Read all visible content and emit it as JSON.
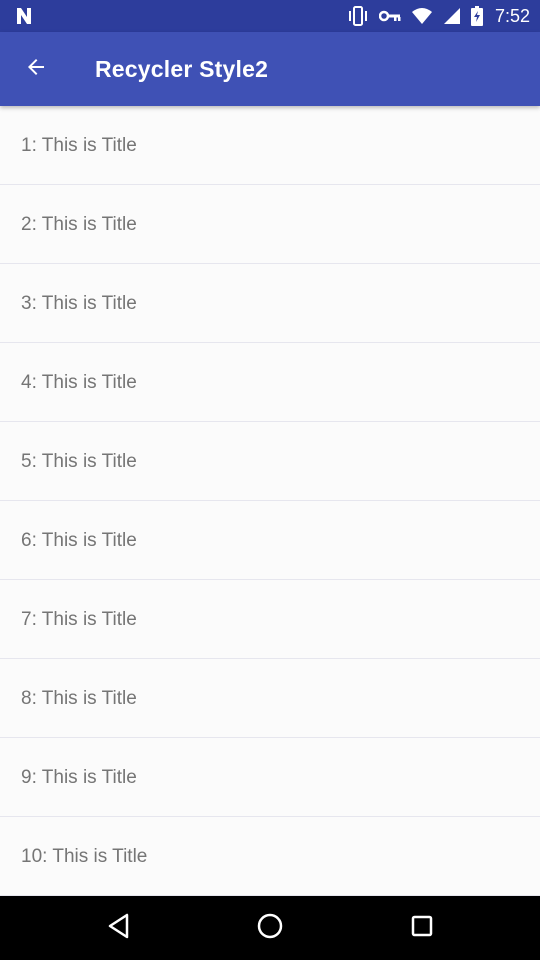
{
  "status_bar": {
    "time": "7:52",
    "icons": [
      "notification-n-icon",
      "vibrate-icon",
      "vpn-key-icon",
      "wifi-icon",
      "signal-icon",
      "battery-icon"
    ]
  },
  "app_bar": {
    "title": "Recycler Style2",
    "back_icon": "arrow-back-icon"
  },
  "list": {
    "items": [
      {
        "title": "1: This is Title"
      },
      {
        "title": "2: This is Title"
      },
      {
        "title": "3: This is Title"
      },
      {
        "title": "4: This is Title"
      },
      {
        "title": "5: This is Title"
      },
      {
        "title": "6: This is Title"
      },
      {
        "title": "7: This is Title"
      },
      {
        "title": "8: This is Title"
      },
      {
        "title": "9: This is Title"
      },
      {
        "title": "10: This is Title"
      }
    ]
  },
  "nav_bar": {
    "buttons": [
      "back-triangle-icon",
      "home-circle-icon",
      "recents-square-icon"
    ]
  },
  "colors": {
    "primary": "#3f51b5",
    "primary_dark": "#2d3d9c",
    "item_text": "#757575",
    "background": "#fafafa"
  }
}
